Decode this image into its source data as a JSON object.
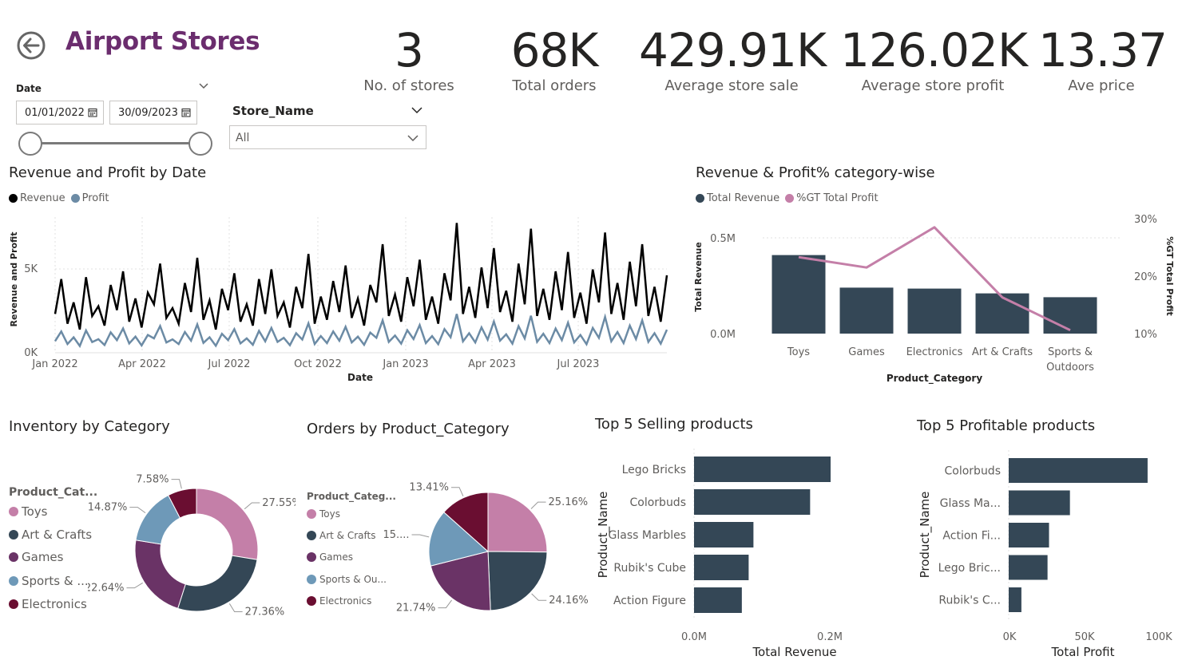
{
  "header": {
    "title": "Airport Stores",
    "back_icon": "back-arrow-icon"
  },
  "kpis": [
    {
      "value": "3",
      "label": "No. of stores"
    },
    {
      "value": "68K",
      "label": "Total orders"
    },
    {
      "value": "429.91K",
      "label": "Average store sale"
    },
    {
      "value": "126.02K",
      "label": "Average store profit"
    },
    {
      "value": "13.37",
      "label": "Ave price"
    }
  ],
  "date_slicer": {
    "label": "Date",
    "start": "01/01/2022",
    "end": "30/09/2023",
    "range_fraction": [
      0,
      1
    ]
  },
  "store_slicer": {
    "label": "Store_Name",
    "selected": "All"
  },
  "colors": {
    "toys": "#C47FA8",
    "art_crafts": "#344756",
    "games": "#6A3366",
    "sports_outdoors": "#6E99B8",
    "electronics": "#6A0E31",
    "bar": "#344756",
    "line_profit_pct": "#C47FA8",
    "revenue_line": "#000000",
    "profit_line": "#6C8BA5",
    "title_purple": "#6B2D6E"
  },
  "charts": {
    "revenue_profit_by_date": {
      "title": "Revenue and Profit by Date",
      "legend": [
        "Revenue",
        "Profit"
      ],
      "xlabel": "Date",
      "ylabel": "Revenue and Profit",
      "x_ticks": [
        "Jan 2022",
        "Apr 2022",
        "Jul 2022",
        "Oct 2022",
        "Jan 2023",
        "Apr 2023",
        "Jul 2023"
      ],
      "y_ticks": [
        "0K",
        "5K"
      ]
    },
    "category_revenue_profit": {
      "title": "Revenue & Profit% category-wise",
      "legend": [
        "Total Revenue",
        "%GT Total Profit"
      ],
      "xlabel": "Product_Category",
      "ylabel": "Total Revenue",
      "y2label": "%GT Total Profit",
      "y_ticks": [
        "0.0M",
        "0.5M"
      ],
      "y2_ticks": [
        "10%",
        "20%",
        "30%"
      ],
      "category_labels": [
        [
          "Toys"
        ],
        [
          "Games"
        ],
        [
          "Electronics"
        ],
        [
          "Art & Crafts"
        ],
        [
          "Sports &",
          "Outdoors"
        ]
      ]
    },
    "inventory_by_category": {
      "title": "Inventory by Category",
      "legend_title": "Product_Cat...",
      "legend": [
        "Toys",
        "Art & Crafts",
        "Games",
        "Sports & ...",
        "Electronics"
      ],
      "labels": [
        "27.55%",
        "27.36%",
        "22.64%",
        "14.87%",
        "7.58%"
      ]
    },
    "orders_by_category": {
      "title": "Orders by Product_Category",
      "legend_title": "Product_Categ...",
      "legend": [
        "Toys",
        "Art & Crafts",
        "Games",
        "Sports & Ou...",
        "Electronics"
      ],
      "labels": [
        "25.16%",
        "24.16%",
        "21.74%",
        "15....",
        "13.41%"
      ]
    },
    "top_selling": {
      "title": "Top 5 Selling products",
      "ylabel": "Product_Name",
      "xlabel": "Total Revenue",
      "x_ticks": [
        "0.0M",
        "0.2M"
      ],
      "labels": [
        "Lego Bricks",
        "Colorbuds",
        "Glass Marbles",
        "Rubik's Cube",
        "Action Figure"
      ]
    },
    "top_profitable": {
      "title": "Top 5 Profitable products",
      "ylabel": "Product_Name",
      "xlabel": "Total Profit",
      "x_ticks": [
        "0K",
        "50K",
        "100K"
      ],
      "labels": [
        "Colorbuds",
        "Glass Ma...",
        "Action Fi...",
        "Lego Bric...",
        "Rubik's C..."
      ]
    }
  },
  "chart_data": [
    {
      "type": "line",
      "title": "Revenue and Profit by Date",
      "xlabel": "Date",
      "ylabel": "Revenue and Profit",
      "x_range": [
        "2022-01-01",
        "2023-09-30"
      ],
      "ylim": [
        0,
        7000
      ],
      "series": [
        {
          "name": "Revenue",
          "values": [
            2000,
            3800,
            1500,
            2600,
            1200,
            3900,
            1900,
            2400,
            1400,
            3500,
            2200,
            4200,
            1600,
            2800,
            1300,
            3100,
            2500,
            4600,
            1800,
            2300,
            1500,
            3600,
            2100,
            4900,
            1700,
            2700,
            1200,
            3300,
            2200,
            4100,
            1600,
            2500,
            1400,
            3800,
            2000,
            4300,
            1900,
            2600,
            1300,
            3400,
            2300,
            5100,
            1500,
            2900,
            1700,
            3700,
            2100,
            4500,
            1800,
            2800,
            1400,
            3500,
            2600,
            5600,
            1900,
            3000,
            1600,
            3900,
            2400,
            4800,
            1700,
            2900,
            1500,
            4100,
            2700,
            6700,
            2000,
            3400,
            1800,
            4400,
            2300,
            5400,
            2100,
            3200,
            1600,
            4600,
            2500,
            6400,
            1900,
            3300,
            1700,
            4200,
            2200,
            5200,
            1800,
            3100,
            1500,
            4300,
            2600,
            6200,
            2000,
            3600,
            1700,
            4700,
            2400,
            5600,
            1900,
            3400,
            1600,
            4000
          ]
        },
        {
          "name": "Profit",
          "values": [
            600,
            1100,
            450,
            800,
            350,
            1150,
            550,
            700,
            400,
            1050,
            650,
            1250,
            480,
            830,
            380,
            920,
            740,
            1380,
            530,
            690,
            450,
            1070,
            620,
            1460,
            510,
            800,
            360,
            980,
            650,
            1220,
            480,
            740,
            410,
            1130,
            590,
            1280,
            560,
            770,
            390,
            1010,
            680,
            1520,
            450,
            860,
            500,
            1100,
            620,
            1340,
            530,
            830,
            410,
            1040,
            770,
            1670,
            560,
            890,
            470,
            1160,
            710,
            1430,
            500,
            860,
            440,
            1220,
            800,
            2000,
            590,
            1010,
            530,
            1310,
            680,
            1610,
            620,
            950,
            470,
            1370,
            740,
            1910,
            560,
            980,
            500,
            1250,
            650,
            1550,
            530,
            920,
            440,
            1280,
            770,
            1850,
            590,
            1070,
            500,
            1400,
            710,
            1670,
            560,
            1010,
            470,
            1190
          ]
        }
      ]
    },
    {
      "type": "bar",
      "title": "Revenue & Profit% category-wise",
      "categories": [
        "Toys",
        "Games",
        "Electronics",
        "Art & Crafts",
        "Sports & Outdoors"
      ],
      "xlabel": "Product_Category",
      "ylabel": "Total Revenue",
      "ylim": [
        0,
        0.6
      ],
      "y2lim": [
        10,
        30
      ],
      "series": [
        {
          "name": "Total Revenue",
          "type": "bar",
          "axis": "left",
          "unit": "M",
          "values": [
            0.41,
            0.24,
            0.235,
            0.21,
            0.19
          ]
        },
        {
          "name": "%GT Total Profit",
          "type": "line",
          "axis": "right",
          "unit": "%",
          "values": [
            23.3,
            21.5,
            28.5,
            16.3,
            10.6
          ]
        }
      ]
    },
    {
      "type": "pie",
      "subtype": "donut",
      "title": "Inventory by Category",
      "categories": [
        "Toys",
        "Art & Crafts",
        "Games",
        "Sports & Outdoors",
        "Electronics"
      ],
      "values": [
        27.55,
        27.36,
        22.64,
        14.87,
        7.58
      ]
    },
    {
      "type": "pie",
      "title": "Orders by Product_Category",
      "categories": [
        "Toys",
        "Art & Crafts",
        "Games",
        "Sports & Outdoors",
        "Electronics"
      ],
      "values": [
        25.16,
        24.16,
        21.74,
        15.53,
        13.41
      ]
    },
    {
      "type": "bar",
      "orientation": "horizontal",
      "title": "Top 5 Selling products",
      "xlabel": "Total Revenue",
      "ylabel": "Product_Name",
      "categories": [
        "Lego Bricks",
        "Colorbuds",
        "Glass Marbles",
        "Rubik's Cube",
        "Action Figure"
      ],
      "values": [
        0.2,
        0.17,
        0.087,
        0.08,
        0.07
      ],
      "unit": "M",
      "xlim": [
        0,
        0.2
      ]
    },
    {
      "type": "bar",
      "orientation": "horizontal",
      "title": "Top 5 Profitable products",
      "xlabel": "Total Profit",
      "ylabel": "Product_Name",
      "categories": [
        "Colorbuds",
        "Glass Marbles",
        "Action Figure",
        "Lego Bricks",
        "Rubik's Cube"
      ],
      "values": [
        93000,
        41000,
        27000,
        26000,
        8500
      ],
      "xlim": [
        0,
        100000
      ]
    }
  ]
}
